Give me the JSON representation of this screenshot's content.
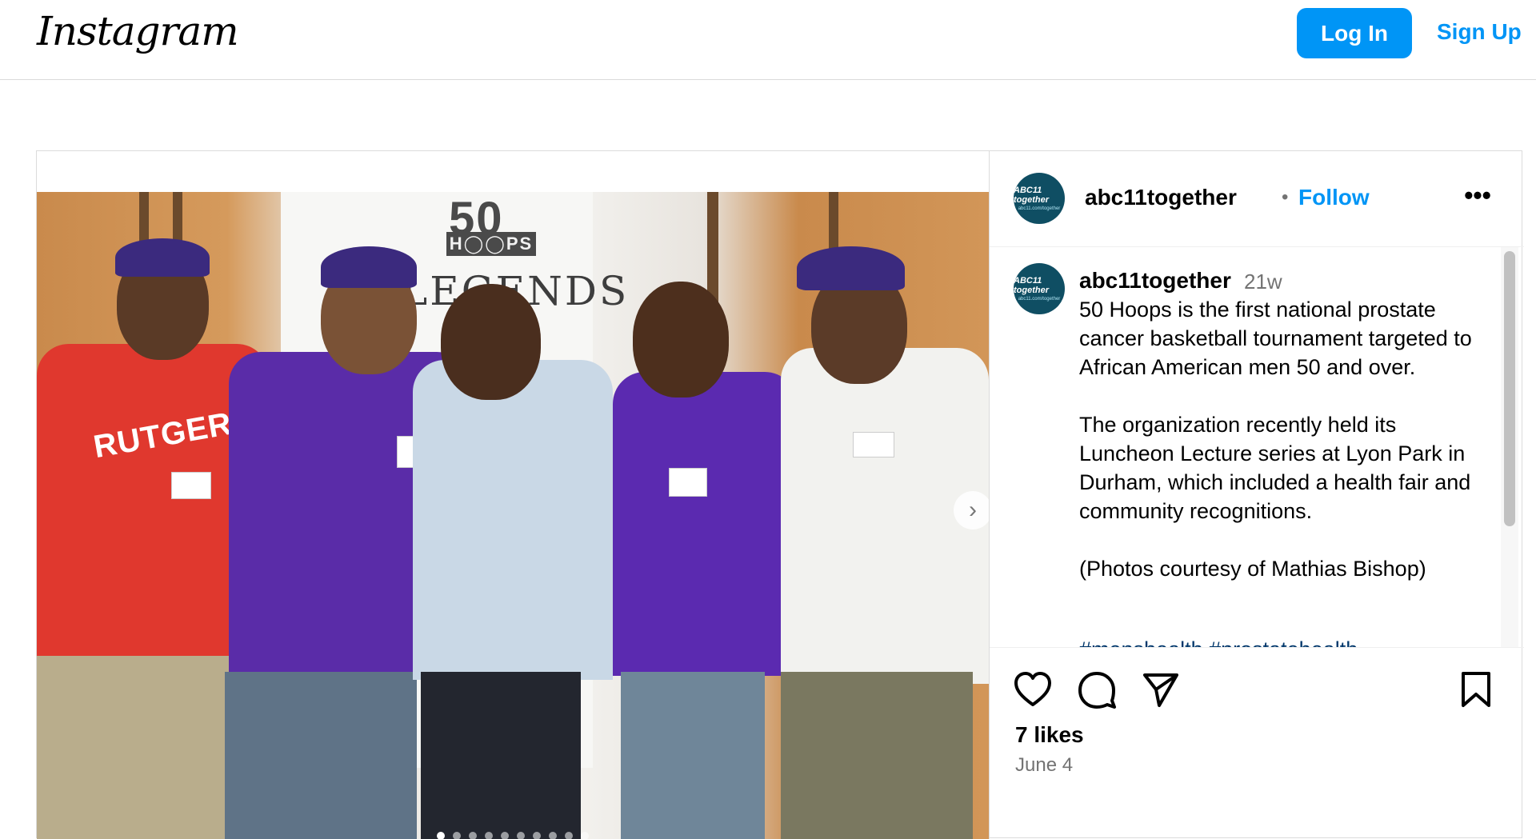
{
  "header": {
    "logo_text": "Instagram",
    "login_label": "Log In",
    "signup_label": "Sign Up"
  },
  "post": {
    "username": "abc11together",
    "separator": "•",
    "follow_label": "Follow",
    "more_label": "•••",
    "avatar_text": "ABC11 together",
    "avatar_subtext": "abc11.com/together",
    "photo": {
      "banner_number": "50",
      "banner_hoops": "H◯◯PS",
      "banner_word": "LEGENDS",
      "shirt_text": "RUTGERS",
      "carousel_count": 10,
      "carousel_active_index": 0
    },
    "caption": {
      "username": "abc11together",
      "time": "21w",
      "text": "50 Hoops is the first national prostate cancer basketball tournament targeted to African American men 50 and over.\n\nThe organization recently held its Luncheon Lecture series at Lyon Park in Durham, which included a health fair and community recognitions.\n\n(Photos courtesy of Mathias Bishop)",
      "tags": "#menshealth #prostatehealth"
    },
    "likes": "7 likes",
    "date": "June 4"
  },
  "icons": {
    "like": "heart-icon",
    "comment": "comment-icon",
    "share": "share-icon",
    "save": "bookmark-icon",
    "next": "chevron-right-icon"
  },
  "colors": {
    "accent": "#0095f6",
    "muted": "#737373",
    "border": "#dbdbdb",
    "hashtag": "#00376b"
  }
}
